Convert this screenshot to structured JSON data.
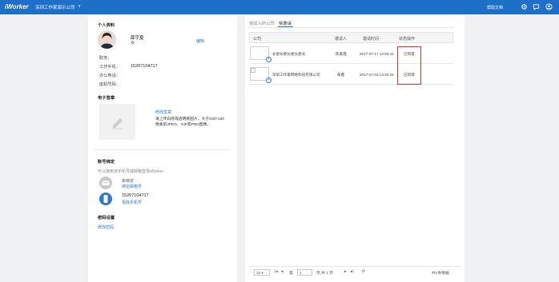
{
  "topbar": {
    "logo": "iWorker",
    "company": "深圳工作家演示公司",
    "caret": "▾",
    "help": "帮助文档",
    "icons": [
      "gear-icon",
      "chat-icon",
      "user-icon"
    ]
  },
  "profile": {
    "section_title": "个人资料",
    "name": "薛宇夏",
    "gender": "女",
    "edit": "编辑",
    "fields": [
      {
        "label": "职务：",
        "value": ""
      },
      {
        "label": "工作手机：",
        "value": "15207104717"
      },
      {
        "label": "办公电话：",
        "value": ""
      },
      {
        "label": "座机号码：",
        "value": ""
      }
    ]
  },
  "signature": {
    "section_title": "电子签章",
    "edit_link": "修改签章",
    "hint": "请上传白底或透明底图片，大于200×100像素的JPEG、GIF或PNG图像。"
  },
  "account": {
    "section_title": "账号绑定",
    "hint": "可以使用该手机号或邮箱登录iWorker",
    "email_status": "未绑定",
    "email_link": "绑定邮箱号",
    "phone": "15207104717",
    "phone_link": "更改手机号"
  },
  "password": {
    "section_title": "密码设置",
    "link": "修改密码"
  },
  "tabs": [
    {
      "label": "我加入的公司",
      "active": false
    },
    {
      "label": "受邀请",
      "active": true
    }
  ],
  "table": {
    "headers": [
      "公司",
      "邀请人",
      "邀请时间",
      "状态操作"
    ],
    "rows": [
      {
        "company": "长委长委长委长委长",
        "inviter": "陈素霞",
        "time": "2017-07-17 12:50:42",
        "status": "已同意"
      },
      {
        "company": "深圳工作家网络科技有限公司",
        "inviter": "朱鑫",
        "time": "2017-07-03 14:25:25",
        "status": "已同意"
      }
    ]
  },
  "pager": {
    "page_size": "10",
    "page_prefix": "第",
    "page": "1",
    "page_suffix": "页,共 1 页",
    "total": "共2条数据"
  },
  "colors": {
    "primary": "#1e6fc8",
    "link": "#2b78d3",
    "highlight": "#d9342b"
  }
}
